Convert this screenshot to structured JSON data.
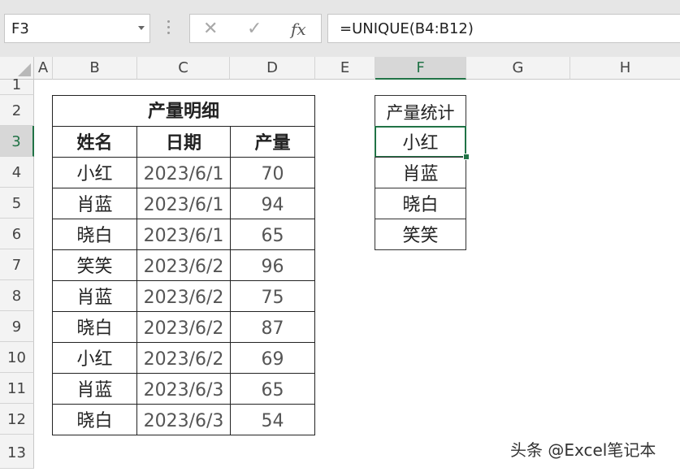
{
  "formula_bar": {
    "name_box": "F3",
    "cancel_icon": "close-icon",
    "enter_icon": "check-icon",
    "fx_label": "fx",
    "formula": "=UNIQUE(B4:B12)"
  },
  "columns": [
    "A",
    "B",
    "C",
    "D",
    "E",
    "F",
    "G",
    "H"
  ],
  "rows": [
    "1",
    "2",
    "3",
    "4",
    "5",
    "6",
    "7",
    "8",
    "9",
    "10",
    "11",
    "12",
    "13"
  ],
  "table": {
    "title": "产量明细",
    "headers": [
      "姓名",
      "日期",
      "产量"
    ],
    "rows": [
      [
        "小红",
        "2023/6/1",
        "70"
      ],
      [
        "肖蓝",
        "2023/6/1",
        "94"
      ],
      [
        "晓白",
        "2023/6/1",
        "65"
      ],
      [
        "笑笑",
        "2023/6/2",
        "96"
      ],
      [
        "肖蓝",
        "2023/6/2",
        "75"
      ],
      [
        "晓白",
        "2023/6/2",
        "87"
      ],
      [
        "小红",
        "2023/6/2",
        "69"
      ],
      [
        "肖蓝",
        "2023/6/3",
        "65"
      ],
      [
        "晓白",
        "2023/6/3",
        "54"
      ]
    ]
  },
  "summary": {
    "header": "产量统计",
    "values": [
      "小红",
      "肖蓝",
      "晓白",
      "笑笑"
    ]
  },
  "watermark": "头条 @Excel笔记本",
  "colors": {
    "accent": "#217346"
  }
}
